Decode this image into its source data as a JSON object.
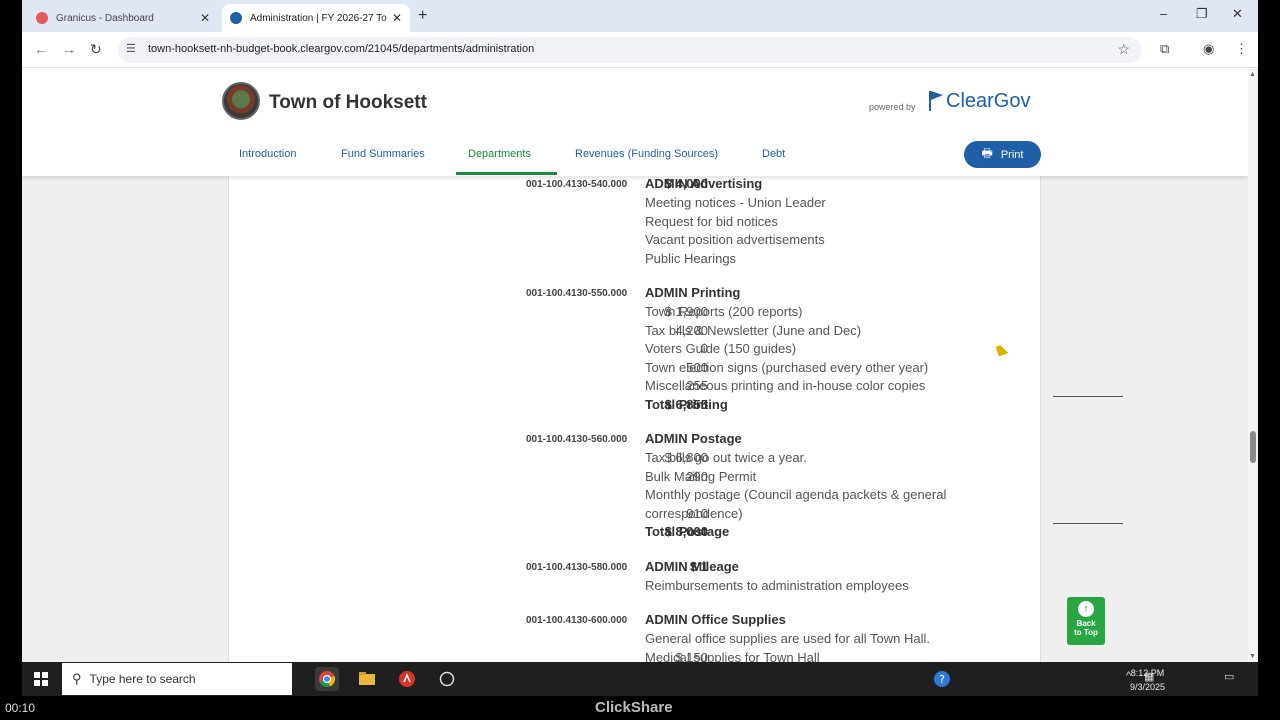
{
  "browser": {
    "tabs": [
      {
        "title": "Granicus - Dashboard",
        "active": false
      },
      {
        "title": "Administration | FY 2026-27 To",
        "active": true
      }
    ],
    "url": "town-hooksett-nh-budget-book.cleargov.com/21045/departments/administration"
  },
  "site": {
    "town_name": "Town of Hooksett",
    "powered_by": "powered by",
    "brand": "ClearGov",
    "nav": [
      "Introduction",
      "Fund Summaries",
      "Departments",
      "Revenues (Funding Sources)",
      "Debt"
    ],
    "active_nav": "Departments",
    "print_label": "Print",
    "back_to_top": [
      "Back",
      "to Top"
    ]
  },
  "budget": [
    {
      "account": "001-100.4130-540.000",
      "title": "ADMIN Advertising",
      "amount": "$ 4,000",
      "lines": [
        {
          "text": "Meeting notices - Union Leader",
          "amount": ""
        },
        {
          "text": "Request for bid notices",
          "amount": ""
        },
        {
          "text": "Vacant position advertisements",
          "amount": ""
        },
        {
          "text": "Public Hearings",
          "amount": ""
        }
      ]
    },
    {
      "account": "001-100.4130-550.000",
      "title": "ADMIN Printing",
      "amount": "",
      "lines": [
        {
          "text": "Town Reports (200 reports)",
          "amount": "$ 1,900"
        },
        {
          "text": "Tax bills & Newsletter (June and Dec)",
          "amount": "4,200"
        },
        {
          "text": "Voters Guide (150 guides)",
          "amount": "0"
        },
        {
          "text": "Town election signs (purchased every other year)",
          "amount": "500"
        },
        {
          "text": "Miscellaneous printing and in-house color copies",
          "amount": "255"
        }
      ],
      "total_label": "Total Printing",
      "total": "$ 6,855"
    },
    {
      "account": "001-100.4130-560.000",
      "title": "ADMIN Postage",
      "amount": "",
      "lines": [
        {
          "text": "Tax bills go out twice a year.",
          "amount": "$ 6,800"
        },
        {
          "text": "Bulk Mailing Permit",
          "amount": "290"
        },
        {
          "text": "Monthly postage (Council agenda packets & general",
          "amount": ""
        },
        {
          "text": "correspondence)",
          "amount": "910"
        }
      ],
      "total_label": "Total Postage",
      "total": "$ 8,000"
    },
    {
      "account": "001-100.4130-580.000",
      "title": "ADMIN Mileage",
      "amount": "$ 1",
      "lines": [
        {
          "text": "Reimbursements to administration employees",
          "amount": ""
        }
      ]
    },
    {
      "account": "001-100.4130-600.000",
      "title": "ADMIN Office Supplies",
      "amount": "",
      "lines": [
        {
          "text": "General office supplies are used for all Town Hall.",
          "amount": ""
        },
        {
          "text": "Medical supplies for Town Hall",
          "amount": "$ 150"
        }
      ]
    }
  ],
  "taskbar": {
    "search_placeholder": "Type here to search",
    "time": "8:12 PM",
    "date": "9/3/2025"
  },
  "overlay": {
    "timer": "00:10",
    "clickshare": "ClickShare"
  }
}
